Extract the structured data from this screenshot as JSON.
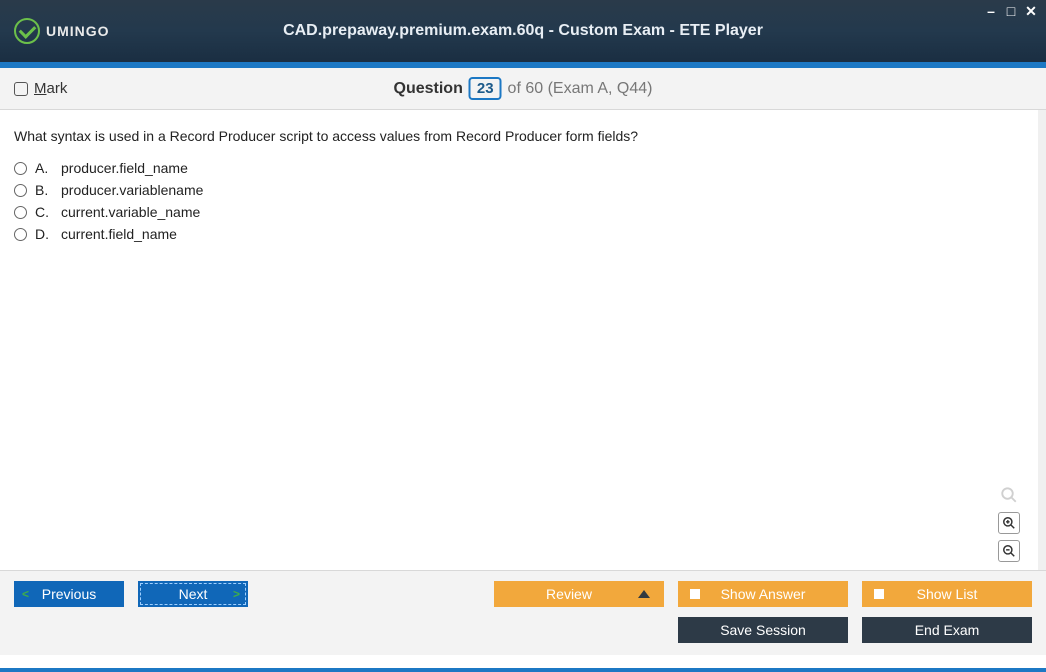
{
  "title": "CAD.prepaway.premium.exam.60q - Custom Exam - ETE Player",
  "logo": "UMINGO",
  "mark": {
    "prefix": "M",
    "rest": "ark"
  },
  "question_bar": {
    "label": "Question",
    "number": "23",
    "rest": "of 60 (Exam A, Q44)"
  },
  "question": "What syntax is used in a Record Producer script to access values from Record Producer form fields?",
  "options": [
    {
      "letter": "A.",
      "text": "producer.field_name"
    },
    {
      "letter": "B.",
      "text": "producer.variablename"
    },
    {
      "letter": "C.",
      "text": "current.variable_name"
    },
    {
      "letter": "D.",
      "text": "current.field_name"
    }
  ],
  "buttons": {
    "previous": "Previous",
    "next": "Next",
    "review": "Review",
    "show_answer": "Show Answer",
    "show_list": "Show List",
    "save_session": "Save Session",
    "end_exam": "End Exam"
  }
}
